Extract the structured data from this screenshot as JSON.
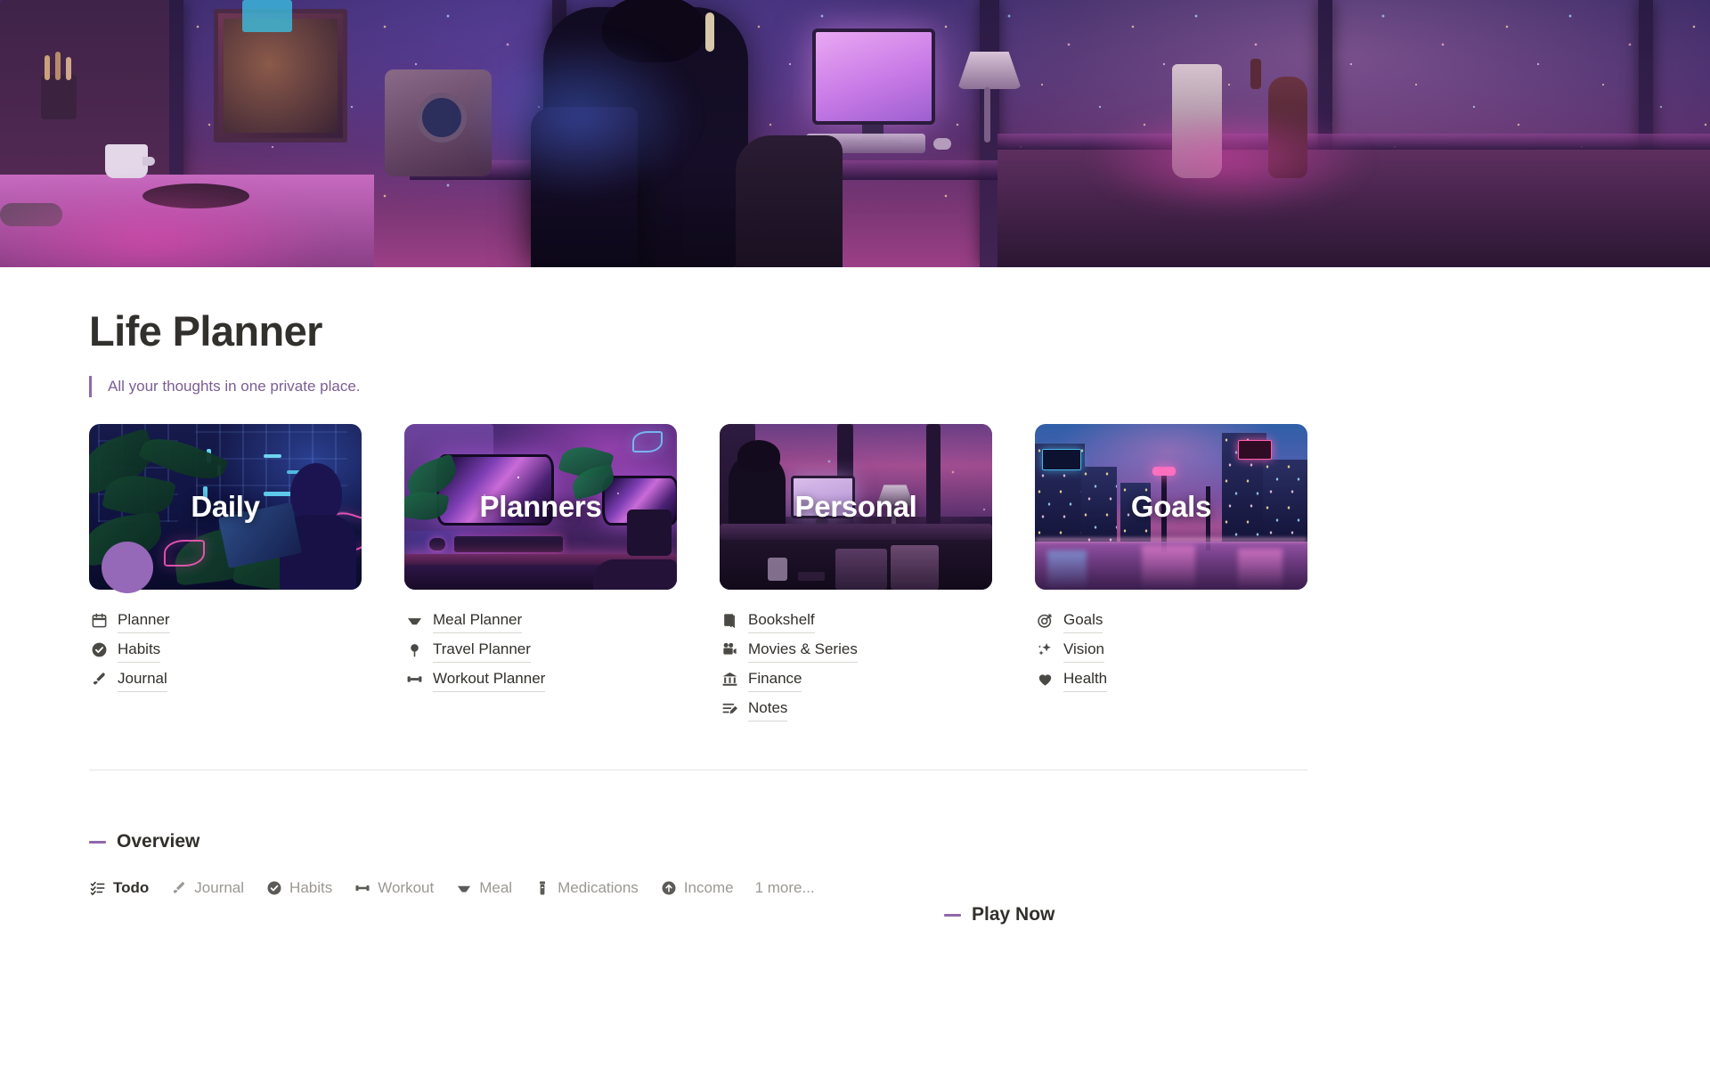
{
  "cover": {
    "alt": "lofi-night-desk-city-cover"
  },
  "header": {
    "title": "Life Planner",
    "quote": "All your thoughts in one private place."
  },
  "colors": {
    "accent_purple": "#9168ab",
    "quote_text": "#7b5e92",
    "avatar": "#9568b8",
    "text_dark": "#32302c",
    "text_muted": "#9b9894",
    "divider": "#e6e4e0"
  },
  "cards": [
    {
      "banner_title": "Daily",
      "scene": "dark-blue-plant-room",
      "links": [
        {
          "label": "Planner",
          "icon": "calendar-icon"
        },
        {
          "label": "Habits",
          "icon": "check-circle-icon"
        },
        {
          "label": "Journal",
          "icon": "paintbrush-icon"
        }
      ]
    },
    {
      "banner_title": "Planners",
      "scene": "neon-desk-setup",
      "links": [
        {
          "label": "Meal Planner",
          "icon": "bowl-icon"
        },
        {
          "label": "Travel Planner",
          "icon": "map-pin-icon"
        },
        {
          "label": "Workout Planner",
          "icon": "dumbbell-icon"
        }
      ]
    },
    {
      "banner_title": "Personal",
      "scene": "person-at-window-desk",
      "links": [
        {
          "label": "Bookshelf",
          "icon": "book-icon"
        },
        {
          "label": "Movies & Series",
          "icon": "movie-camera-icon"
        },
        {
          "label": "Finance",
          "icon": "bank-icon"
        },
        {
          "label": "Notes",
          "icon": "notes-edit-icon"
        }
      ]
    },
    {
      "banner_title": "Goals",
      "scene": "cyberpunk-street",
      "links": [
        {
          "label": "Goals",
          "icon": "target-icon"
        },
        {
          "label": "Vision",
          "icon": "sparkles-icon"
        },
        {
          "label": "Health",
          "icon": "heart-icon"
        }
      ]
    }
  ],
  "overview": {
    "heading": "Overview",
    "tabs": [
      {
        "label": "Todo",
        "icon": "checklist-icon",
        "active": true
      },
      {
        "label": "Journal",
        "icon": "paintbrush-icon",
        "active": false
      },
      {
        "label": "Habits",
        "icon": "check-circle-icon",
        "active": false
      },
      {
        "label": "Workout",
        "icon": "dumbbell-icon",
        "active": false
      },
      {
        "label": "Meal",
        "icon": "bowl-icon",
        "active": false
      },
      {
        "label": "Medications",
        "icon": "pill-bottle-icon",
        "active": false
      },
      {
        "label": "Income",
        "icon": "arrow-up-circle-icon",
        "active": false
      }
    ],
    "more_label": "1 more..."
  },
  "play_now": {
    "heading": "Play Now"
  }
}
